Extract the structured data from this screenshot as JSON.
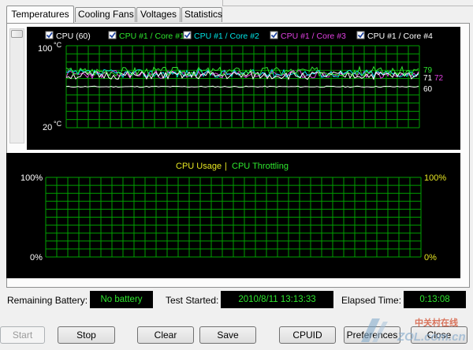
{
  "tabs": [
    {
      "label": "Temperatures",
      "active": true
    },
    {
      "label": "Cooling Fans",
      "active": false
    },
    {
      "label": "Voltages",
      "active": false
    },
    {
      "label": "Statistics",
      "active": false
    }
  ],
  "temperature_graph": {
    "legend": [
      {
        "label": "CPU (60)",
        "checked": true,
        "color": "#ffffff"
      },
      {
        "label": "CPU #1 / Core #1",
        "checked": true,
        "color": "#2ee62e"
      },
      {
        "label": "CPU #1 / Core #2",
        "checked": true,
        "color": "#00e5e5"
      },
      {
        "label": "CPU #1 / Core #3",
        "checked": true,
        "color": "#e040e0"
      },
      {
        "label": "CPU #1 / Core #4",
        "checked": true,
        "color": "#ffffff"
      }
    ],
    "y_top_label": "100",
    "y_bottom_label": "20",
    "unit": "°C",
    "end_labels": [
      {
        "text": "79",
        "color": "#2ee62e"
      },
      {
        "text": "71",
        "color": "#ffffff"
      },
      {
        "text": "72",
        "color": "#e040e0"
      },
      {
        "text": "60",
        "color": "#ffffff"
      }
    ]
  },
  "usage_graph": {
    "title_left": "CPU Usage",
    "separator": "|",
    "title_right": "CPU Throttling",
    "left_top": "100%",
    "left_bottom": "0%",
    "right_top": "100%",
    "right_bottom": "0%",
    "color_usage": "#e6e622",
    "color_throttle": "#2ee62e"
  },
  "status": {
    "battery_label": "Remaining Battery:",
    "battery_value": "No battery",
    "test_started_label": "Test Started:",
    "test_started_value": "2010/8/11 13:13:33",
    "elapsed_label": "Elapsed Time:",
    "elapsed_value": "0:13:08"
  },
  "buttons": {
    "start": "Start",
    "stop": "Stop",
    "clear": "Clear",
    "save": "Save",
    "cpuid": "CPUID",
    "preferences": "Preferences",
    "close": "Close"
  },
  "watermark": {
    "line1": "中关村在线",
    "line2": "ZOL.com.cn"
  },
  "colors": {
    "grid": "#00a000",
    "graph_bg": "#000000",
    "status_text": "#2ee62e"
  }
}
